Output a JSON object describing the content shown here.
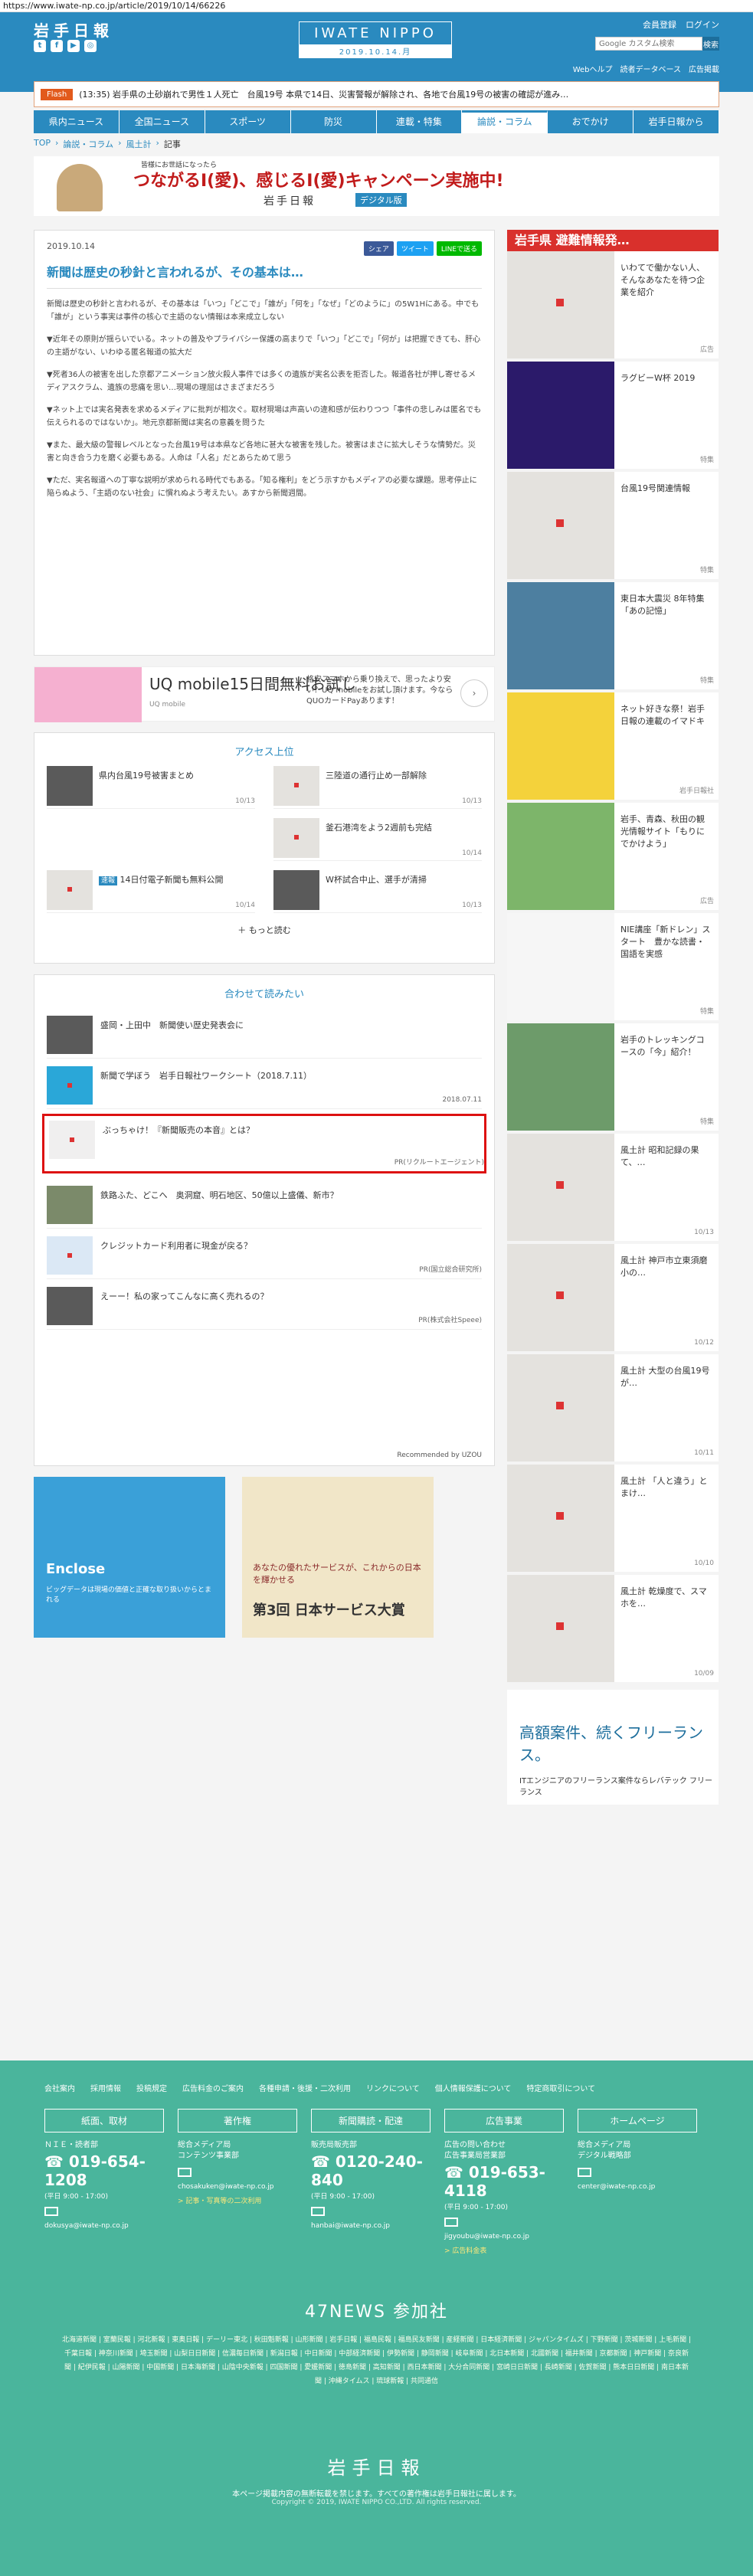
{
  "url": "https://www.iwate-np.co.jp/article/2019/10/14/66226",
  "header": {
    "brand": "岩手日報",
    "center_title": "IWATE NIPPO",
    "center_date": "2019.10.14.月",
    "member_register": "会員登録",
    "login": "ログイン",
    "search_placeholder": "Google カスタム検索",
    "search_button": "検索",
    "links": [
      "Webヘルプ",
      "読者データベース",
      "広告掲載"
    ]
  },
  "flash": {
    "label": "Flash",
    "text": "(13:35) 岩手県の土砂崩れで男性１人死亡　台風19号 本県で14日、災害警報が解除され、各地で台風19号の被害の確認が進み…"
  },
  "nav": [
    "県内ニュース",
    "全国ニュース",
    "スポーツ",
    "防災",
    "連載・特集",
    "論説・コラム",
    "おでかけ",
    "岩手日報から"
  ],
  "breadcrumb": [
    "TOP",
    "論説・コラム",
    "風土計",
    "記事"
  ],
  "banner": {
    "sub": "皆様にお世話になったら",
    "title": "つながるI(愛)、感じるI(愛)キャンペーン実施中!",
    "logo": "岩手日報",
    "digital": "デジタル版"
  },
  "article": {
    "date": "2019.10.14",
    "share": [
      "シェア",
      "ツイート",
      "LINEで送る"
    ],
    "title": "新聞は歴史の秒針と言われるが、その基本は…",
    "paragraphs": [
      "新聞は歴史の秒針と言われるが、その基本は「いつ」「どこで」「誰が」「何を」「なぜ」「どのように」の5W1Hにある。中でも「誰が」という事実は事件の核心で主語のない情報は本来成立しない",
      "▼近年その原則が揺らいでいる。ネットの普及やプライバシー保護の高まりで「いつ」「どこで」「何が」は把握できても、肝心の主語がない、いわゆる匿名報道の拡大だ",
      "▼死者36人の被害を出した京都アニメーション放火殺人事件では多くの遺族が実名公表を拒否した。報道各社が押し寄せるメディアスクラム、遺族の悲痛を思い…現場の理屈はさまざまだろう",
      "▼ネット上では実名発表を求めるメディアに批判が相次ぐ。取材現場は声高いの違和感が伝わりつつ「事件の悲しみは匿名でも伝えられるのではないか」。地元京都新聞は実名の意義を問うた",
      "▼また、最大級の警報レベルとなった台風19号は本県など各地に甚大な被害を残した。被害はまさに拡大しそうな情勢だ。災害と向き合う力を磨く必要もある。人命は「人名」だとあらためて思う",
      "▼ただ、実名報道への丁寧な説明が求められる時代でもある。「知る権利」をどう示すかもメディアの必要な課題。思考停止に陥らぬよう、「主語のない社会」に慣れぬよう考えたい。あすから新聞週間。"
    ]
  },
  "ad1": {
    "headline": "UQ mobile15日間無料お試し",
    "source": "UQ mobile",
    "desc": "格安スマホから乗り換えで、思ったより安い？UQ mobileをお試し頂けます。今ならQUOカードPayあります！"
  },
  "access": {
    "heading": "アクセス上位",
    "items": [
      {
        "title": "県内台風19号被害まとめ",
        "date": "10/13"
      },
      {
        "title": "三陸道の通行止め一部解除",
        "date": "10/13"
      },
      {
        "title": "釜石港湾をよう2週前も完結",
        "date": "10/14"
      },
      {
        "title": "",
        "date": ""
      },
      {
        "badge": "速報",
        "title": "14日付電子新聞も無料公開",
        "date": "10/14"
      },
      {
        "title": "W杯試合中止、選手が清掃",
        "date": "10/13"
      }
    ],
    "more": "もっと読む"
  },
  "related": {
    "heading": "合わせて読みたい",
    "items": [
      {
        "title": "盛岡・上田中　新聞使い歴史発表会に",
        "meta": ""
      },
      {
        "title": "新聞で学ぼう　岩手日報社ワークシート（2018.7.11）",
        "meta": "2018.07.11"
      },
      {
        "title": "ぶっちゃけ！『新聞販売の本音』とは？",
        "meta": "PR(リクルートエージェント)"
      },
      {
        "title": "鉄路ふた、どこへ　奥洞窟、明石地区、50億以上盛儀、新市？",
        "meta": ""
      },
      {
        "title": "クレジットカード利用者に現金が戻る？",
        "meta": "PR(国立総合研究所)"
      },
      {
        "title": "えーー！私の家ってこんなに高く売れるの？",
        "meta": "PR(株式会社Speee)"
      }
    ],
    "recommended": "Recommended by UZOU"
  },
  "bigads": [
    {
      "label": "Enclose",
      "text": "ビッグデータは現場の価値と正確な取り扱いからとまれる"
    },
    {
      "label": "第3回 日本サービス大賞",
      "text": "あなたの優れたサービスが、これからの日本を輝かせる"
    }
  ],
  "sidebar": {
    "header": "岩手県  避難情報発…",
    "items": [
      {
        "title": "いわてで働かない人、そんなあなたを待つ企業を紹介",
        "meta": "広告"
      },
      {
        "title": "ラグビーW杯 2019",
        "meta": "特集"
      },
      {
        "title": "台風19号関連情報",
        "meta": "特集"
      },
      {
        "title": "東日本大震災 8年特集「あの記憶」",
        "meta": "特集"
      },
      {
        "title": "ネット好きな祭！岩手日報の連載のイマドキ",
        "meta": "岩手日報社"
      },
      {
        "title": "岩手、青森、秋田の観光情報サイト「もりにでかけよう」",
        "meta": "広告"
      },
      {
        "title": "NIE講座「新ドレン」スタート　豊かな読書・国語を実感",
        "meta": "特集"
      },
      {
        "title": "岩手のトレッキングコースの「今」紹介！",
        "meta": "特集"
      },
      {
        "title": "風土計 昭和記録の果て、…",
        "meta": "10/13"
      },
      {
        "title": "風土計 神戸市立東須磨小の…",
        "meta": "10/12"
      },
      {
        "title": "風土計 大型の台風19号が…",
        "meta": "10/11"
      },
      {
        "title": "風土計 「人と違う」とまけ…",
        "meta": "10/10"
      },
      {
        "title": "風土計 乾燥度で、スマホを…",
        "meta": "10/09"
      }
    ],
    "ad_title": "高額案件、続くフリーランス。",
    "ad_foot": "ITエンジニアのフリーランス案件ならレバテック フリーランス"
  },
  "footer": {
    "links": [
      "会社案内",
      "採用情報",
      "投稿規定",
      "広告料金のご案内",
      "各種申請・後援・二次利用",
      "リンクについて",
      "個人情報保護について",
      "特定商取引について"
    ],
    "columns": [
      {
        "title": "紙面、取材",
        "lines": [
          "ＮＩＥ・読者部"
        ],
        "tel": "019-654-1208",
        "time": "(平日 9:00 - 17:00)",
        "email": "dokusya@iwate-np.co.jp"
      },
      {
        "title": "著作権",
        "lines": [
          "総合メディア局",
          "コンテンツ事業部"
        ],
        "tel": "",
        "time": "",
        "email": "chosakuken@iwate-np.co.jp",
        "note": "> 記事・写真等の二次利用"
      },
      {
        "title": "新聞購読・配達",
        "lines": [
          "販売局販売部"
        ],
        "tel": "0120-240-840",
        "time": "(平日 9:00 - 17:00)",
        "email": "hanbai@iwate-np.co.jp"
      },
      {
        "title": "広告事業",
        "lines": [
          "広告の問い合わせ",
          "広告事業局営業部"
        ],
        "tel": "019-653-4118",
        "time": "(平日 9:00 - 17:00)",
        "email": "jigyoubu@iwate-np.co.jp",
        "note": "> 広告料金表"
      },
      {
        "title": "ホームページ",
        "lines": [
          "総合メディア局",
          "デジタル戦略部"
        ],
        "tel": "",
        "time": "",
        "email": "center@iwate-np.co.jp"
      }
    ],
    "news47": "47NEWS 参加社",
    "news47_list": "北海道新聞 | 室蘭民報 | 河北新報 | 東奥日報 | デーリー東北 | 秋田魁新報 | 山形新聞 | 岩手日報 | 福島民報 | 福島民友新聞 | 産経新聞 | 日本経済新聞 | ジャパンタイムズ | 下野新聞 | 茨城新聞 | 上毛新聞 | 千葉日報 | 神奈川新聞 | 埼玉新聞 | 山梨日日新聞 | 信濃毎日新聞 | 新潟日報 | 中日新聞 | 中部経済新聞 | 伊勢新聞 | 静岡新聞 | 岐阜新聞 | 北日本新聞 | 北國新聞 | 福井新聞 | 京都新聞 | 神戸新聞 | 奈良新聞 | 紀伊民報 | 山陽新聞 | 中国新聞 | 日本海新聞 | 山陰中央新報 | 四国新聞 | 愛媛新聞 | 徳島新聞 | 高知新聞 | 西日本新聞 | 大分合同新聞 | 宮崎日日新聞 | 長崎新聞 | 佐賀新聞 | 熊本日日新聞 | 南日本新聞 | 沖縄タイムス | 琉球新報 | 共同通信",
    "brand": "岩手日報",
    "notice": "本ページ掲載内容の無断転載を禁じます。すべての著作権は岩手日報社に属します。",
    "copyright": "Copyright © 2019, IWATE NIPPO CO.,LTD. All rights reserved."
  }
}
